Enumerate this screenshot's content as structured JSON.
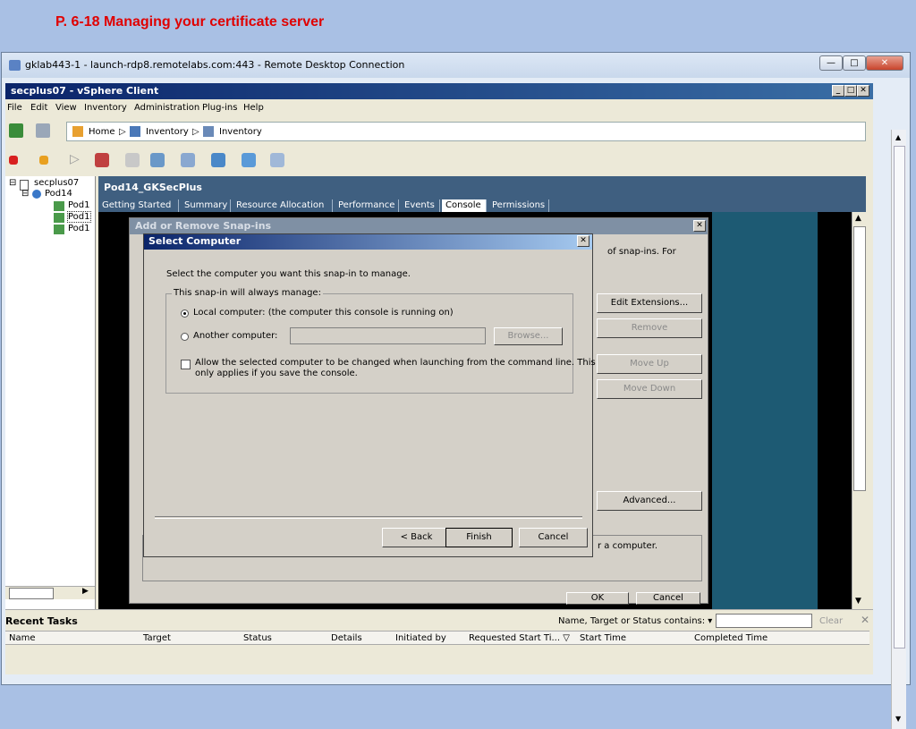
{
  "slide": {
    "title": "P. 6-18 Managing your certificate server"
  },
  "rdp": {
    "title": "gklab443-1 - launch-rdp8.remotelabs.com:443 - Remote Desktop Connection"
  },
  "vsphere": {
    "title": "secplus07 - vSphere Client",
    "menu": [
      "File",
      "Edit",
      "View",
      "Inventory",
      "Administration",
      "Plug-ins",
      "Help"
    ],
    "nav": {
      "home": "Home",
      "inv1": "Inventory",
      "inv2": "Inventory"
    },
    "tree": {
      "root": "secplus07",
      "pod": "Pod14",
      "vm1": "Pod1",
      "vm2": "Pod1",
      "vm3": "Pod1"
    },
    "pod_header": "Pod14_GKSecPlus",
    "tabs": [
      "Getting Started",
      "Summary",
      "Resource Allocation",
      "Performance",
      "Events",
      "Console",
      "Permissions"
    ],
    "active_tab": "Console"
  },
  "snapins": {
    "title": "Add or Remove Snap-ins",
    "snippet_top": "of snap-ins. For",
    "snippet_desc": "r a computer.",
    "buttons": {
      "edit_ext": "Edit Extensions...",
      "remove": "Remove",
      "move_up": "Move Up",
      "move_down": "Move Down",
      "advanced": "Advanced...",
      "ok": "OK",
      "cancel": "Cancel"
    }
  },
  "select_computer": {
    "title": "Select Computer",
    "prompt": "Select the computer you want this snap-in to manage.",
    "group_label": "This snap-in will always manage:",
    "local": "Local computer:  (the computer this console is running on)",
    "another": "Another computer:",
    "browse": "Browse...",
    "allow_line1": "Allow the selected computer to be changed when launching from the command line.  This",
    "allow_line2": "only applies if you save the console.",
    "back": "< Back",
    "finish": "Finish",
    "cancel": "Cancel"
  },
  "tasks": {
    "title": "Recent Tasks",
    "filter_label": "Name, Target or Status contains: ▾",
    "clear": "Clear",
    "columns": [
      "Name",
      "Target",
      "Status",
      "Details",
      "Initiated by",
      "Requested Start Ti... ▽",
      "Start Time",
      "Completed Time"
    ]
  }
}
